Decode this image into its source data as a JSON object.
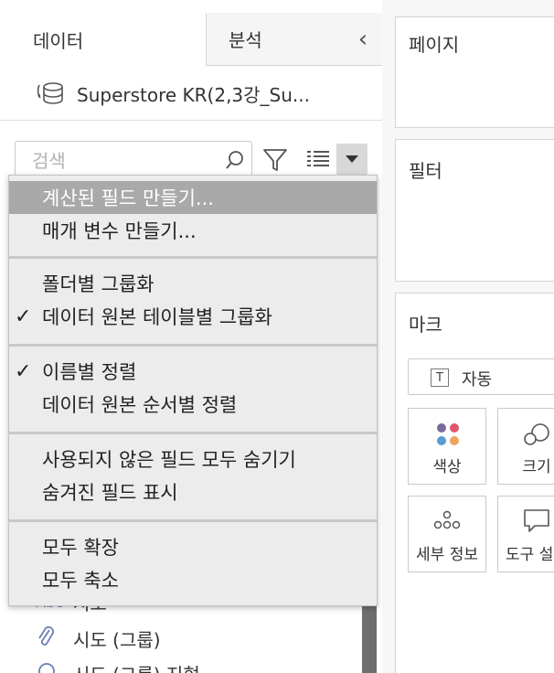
{
  "tabs": {
    "data_label": "데이터",
    "analysis_label": "분석"
  },
  "datasource": {
    "name": "Superstore KR(2,3강_Su..."
  },
  "search": {
    "placeholder": "검색",
    "value": ""
  },
  "menu": {
    "items": [
      {
        "label": "계산된 필드 만들기...",
        "checked": false,
        "highlighted": true
      },
      {
        "label": "매개 변수 만들기...",
        "checked": false,
        "highlighted": false
      },
      {
        "label": "폴더별 그룹화",
        "checked": false,
        "highlighted": false
      },
      {
        "label": "데이터 원본 테이블별 그룹화",
        "checked": true,
        "highlighted": false
      },
      {
        "label": "이름별 정렬",
        "checked": true,
        "highlighted": false
      },
      {
        "label": "데이터 원본 순서별 정렬",
        "checked": false,
        "highlighted": false
      },
      {
        "label": "사용되지 않은 필드 모두 숨기기",
        "checked": false,
        "highlighted": false
      },
      {
        "label": "숨겨진 필드 표시",
        "checked": false,
        "highlighted": false
      },
      {
        "label": "모두 확장",
        "checked": false,
        "highlighted": false
      },
      {
        "label": "모두 축소",
        "checked": false,
        "highlighted": false
      }
    ],
    "check_glyph": "✓"
  },
  "fields": [
    {
      "icon": "abc-icon",
      "icon_text": "Abc",
      "label": "시도"
    },
    {
      "icon": "paperclip-icon",
      "icon_text": "",
      "label": "시도 (그룹)"
    },
    {
      "icon": "geo-icon",
      "icon_text": "",
      "label": "시도 (그룹) 지형"
    }
  ],
  "shelves": {
    "pages_title": "페이지",
    "filters_title": "필터",
    "marks_title": "마크",
    "marks_type": "자동",
    "marks_type_icon_text": "T",
    "color_label": "색상",
    "size_label": "크기",
    "detail_label": "세부 정보",
    "tooltip_label": "도구 설명"
  },
  "colors": {
    "highlight": "#a9a9a9",
    "dot_purple": "#7b6a9c",
    "dot_red": "#e0566b",
    "dot_blue": "#5b9ad5",
    "dot_orange": "#f0a35a"
  }
}
